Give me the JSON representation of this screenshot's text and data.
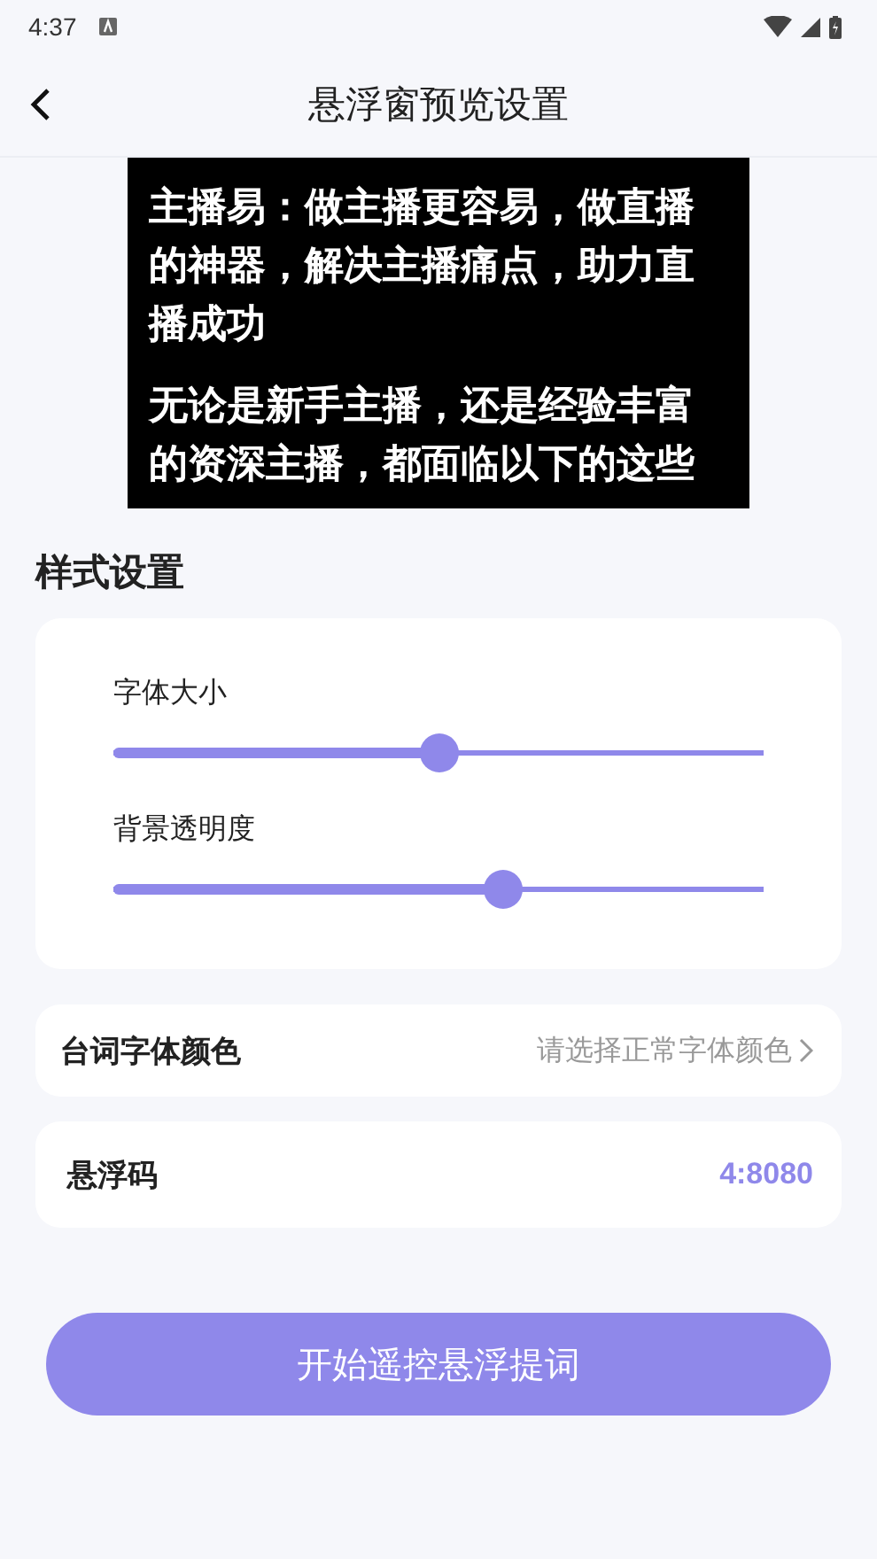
{
  "status_bar": {
    "time": "4:37"
  },
  "header": {
    "title": "悬浮窗预览设置"
  },
  "preview": {
    "paragraphs": [
      "主播易：做主播更容易，做直播的神器，解决主播痛点，助力直播成功",
      "无论是新手主播，还是经验丰富的资深主播，都面临以下的这些"
    ]
  },
  "section_title": "样式设置",
  "sliders": [
    {
      "label": "字体大小",
      "level": 0.5
    },
    {
      "label": "背景透明度",
      "level": 0.6
    }
  ],
  "color_row": {
    "label": "台词字体颜色",
    "placeholder": "请选择正常字体颜色"
  },
  "code_row": {
    "label": "悬浮码",
    "value": "4:8080"
  },
  "start_button": "开始遥控悬浮提词"
}
